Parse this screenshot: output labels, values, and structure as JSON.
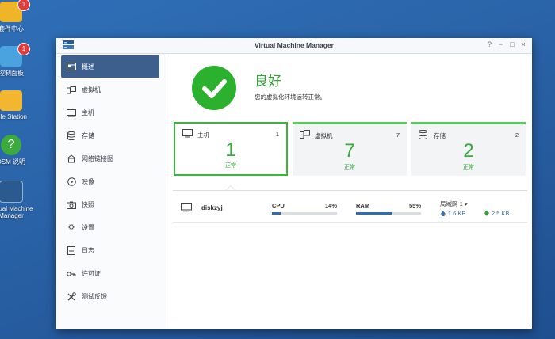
{
  "desktop": {
    "icons": [
      {
        "label": "套件中心",
        "badge": "1"
      },
      {
        "label": "控制面板",
        "badge": "1"
      },
      {
        "label": "File Station"
      },
      {
        "label": "DSM 说明"
      },
      {
        "label": "Virtual Machine Manager"
      }
    ]
  },
  "window": {
    "title": "Virtual Machine Manager",
    "controls": [
      "?",
      "−",
      "□",
      "×"
    ]
  },
  "sidebar": {
    "items": [
      {
        "label": "概述",
        "icon": "overview-icon"
      },
      {
        "label": "虚拟机",
        "icon": "vm-icon"
      },
      {
        "label": "主机",
        "icon": "host-icon"
      },
      {
        "label": "存储",
        "icon": "storage-icon"
      },
      {
        "label": "网络链接图",
        "icon": "network-icon"
      },
      {
        "label": "映像",
        "icon": "image-icon"
      },
      {
        "label": "快照",
        "icon": "snapshot-icon"
      },
      {
        "label": "设置",
        "icon": "gear-icon"
      },
      {
        "label": "日志",
        "icon": "log-icon"
      },
      {
        "label": "许可证",
        "icon": "key-icon"
      },
      {
        "label": "测试反馈",
        "icon": "tools-icon"
      }
    ]
  },
  "status": {
    "title": "良好",
    "description": "您的虚拟化环境运转正常。",
    "color": "#2cb12f"
  },
  "cards": [
    {
      "name": "主机",
      "count": "1",
      "big": "1",
      "state": "正常"
    },
    {
      "name": "虚拟机",
      "count": "7",
      "big": "7",
      "state": "正常"
    },
    {
      "name": "存储",
      "count": "2",
      "big": "2",
      "state": "正常"
    }
  ],
  "host": {
    "name": "diskzyj",
    "cpu": {
      "label": "CPU",
      "value": "14%",
      "fraction": 0.14
    },
    "ram": {
      "label": "RAM",
      "value": "55%",
      "fraction": 0.55
    },
    "network": {
      "title": "局域网 1",
      "up": "1.6 KB",
      "down": "2.5 KB"
    }
  }
}
